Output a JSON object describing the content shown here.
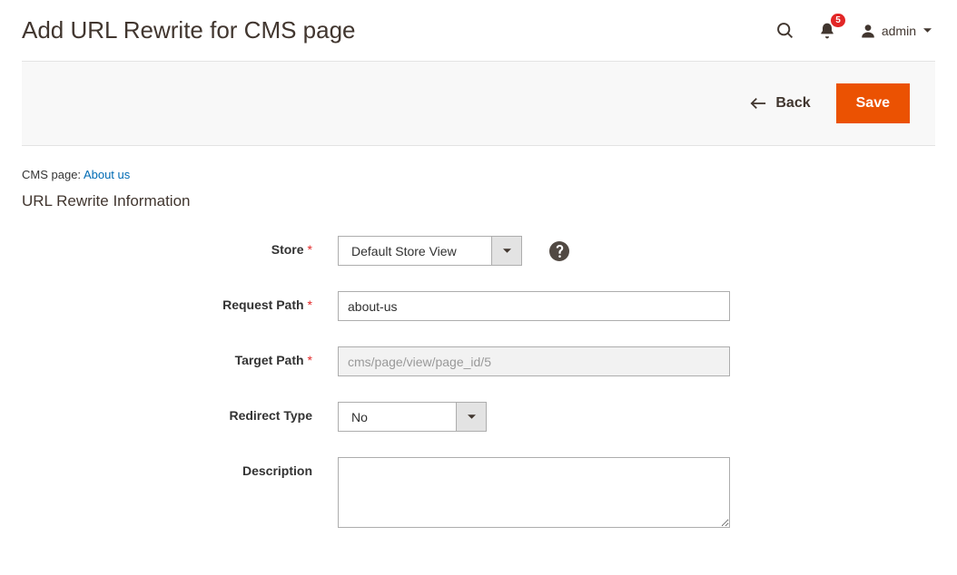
{
  "header": {
    "title": "Add URL Rewrite for CMS page",
    "admin_label": "admin",
    "notification_count": "5"
  },
  "toolbar": {
    "back_label": "Back",
    "save_label": "Save"
  },
  "cms_line": {
    "prefix": "CMS page: ",
    "link_text": "About us"
  },
  "section": {
    "title": "URL Rewrite Information"
  },
  "form": {
    "store": {
      "label": "Store",
      "value": "Default Store View"
    },
    "request_path": {
      "label": "Request Path",
      "value": "about-us"
    },
    "target_path": {
      "label": "Target Path",
      "value": "cms/page/view/page_id/5"
    },
    "redirect_type": {
      "label": "Redirect Type",
      "value": "No"
    },
    "description": {
      "label": "Description",
      "value": ""
    }
  }
}
